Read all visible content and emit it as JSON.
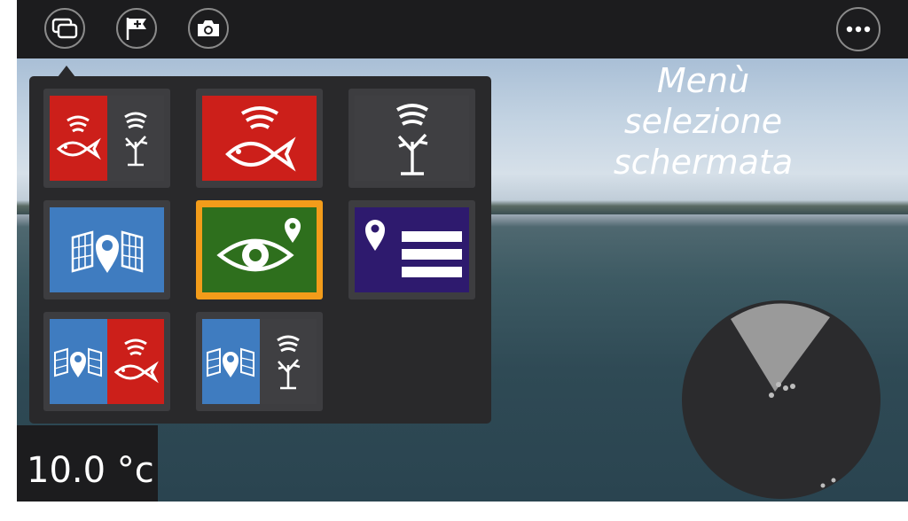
{
  "topbar": {
    "buttons": [
      {
        "name": "screen-select-button",
        "icon": "split-screen-icon"
      },
      {
        "name": "add-waypoint-button",
        "icon": "flag-plus-icon"
      },
      {
        "name": "screenshot-button",
        "icon": "camera-icon"
      },
      {
        "name": "more-menu-button",
        "icon": "ellipsis-icon"
      }
    ]
  },
  "caption": {
    "line1": "Menù",
    "line2": "selezione",
    "line3": "schermata"
  },
  "screen_menu": {
    "tiles": [
      {
        "name": "tile-sonar-downvision",
        "icons": [
          "fish-sonar-icon",
          "tree-downvision-icon"
        ],
        "colors": [
          "#cc1f1a",
          "#3f3f42"
        ]
      },
      {
        "name": "tile-sonar",
        "icons": [
          "fish-sonar-icon"
        ],
        "colors": [
          "#cc1f1a"
        ]
      },
      {
        "name": "tile-downvision",
        "icons": [
          "tree-downvision-icon"
        ],
        "colors": [
          "#3f3f42"
        ]
      },
      {
        "name": "tile-chart",
        "icons": [
          "chart-pin-icon"
        ],
        "colors": [
          "#3f7cc0"
        ]
      },
      {
        "name": "tile-camera",
        "icons": [
          "eye-pin-icon"
        ],
        "colors": [
          "#2e6f1d"
        ],
        "selected": true
      },
      {
        "name": "tile-waypoint-list",
        "icons": [
          "pin-list-icon"
        ],
        "colors": [
          "#2e1a6e"
        ]
      },
      {
        "name": "tile-chart-sonar",
        "icons": [
          "chart-pin-icon",
          "fish-sonar-icon"
        ],
        "colors": [
          "#3f7cc0",
          "#cc1f1a"
        ]
      },
      {
        "name": "tile-chart-downvision",
        "icons": [
          "chart-pin-icon",
          "tree-downvision-icon"
        ],
        "colors": [
          "#3f7cc0",
          "#3f3f42"
        ]
      }
    ],
    "selected_border": "#f39c1a"
  },
  "temperature": {
    "value": "10.0 °c"
  },
  "compass": {
    "icon": "radar-compass-icon"
  }
}
